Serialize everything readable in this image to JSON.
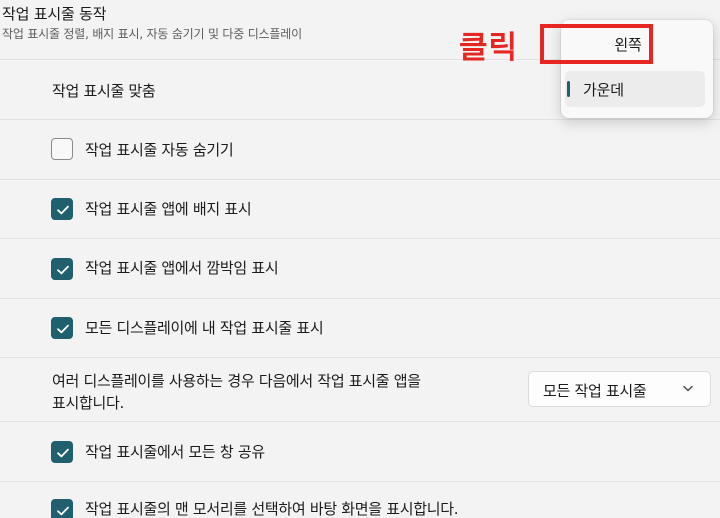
{
  "header": {
    "title": "작업 표시줄 동작",
    "subtitle": "작업 표시줄 정렬, 배지 표시, 자동 숨기기 및 다중 디스플레이"
  },
  "alignment": {
    "label": "작업 표시줄 맞춤",
    "options": [
      "왼쪽",
      "가운데"
    ],
    "selected": "가운데"
  },
  "options": {
    "auto_hide": {
      "label": "작업 표시줄 자동 숨기기",
      "checked": false
    },
    "badges": {
      "label": "작업 표시줄 앱에 배지 표시",
      "checked": true
    },
    "flashing": {
      "label": "작업 표시줄 앱에서 깜박임 표시",
      "checked": true
    },
    "all_displays": {
      "label": "모든 디스플레이에 내 작업 표시줄 표시",
      "checked": true
    },
    "share_window": {
      "label": "작업 표시줄에서 모든 창 공유",
      "checked": true
    },
    "corner_desktop": {
      "label": "작업 표시줄의 맨 모서리를 선택하여 바탕 화면을 표시합니다.",
      "checked": true
    }
  },
  "multi_display": {
    "label_line1": "여러 디스플레이를 사용하는 경우 다음에서 작업 표시줄 앱을",
    "label_line2": "표시합니다.",
    "value": "모든 작업 표시줄"
  },
  "annotation": {
    "text": "클릭",
    "color": "#e52622"
  },
  "colors": {
    "accent": "#1f5f6e",
    "background": "#f3f3f3"
  }
}
